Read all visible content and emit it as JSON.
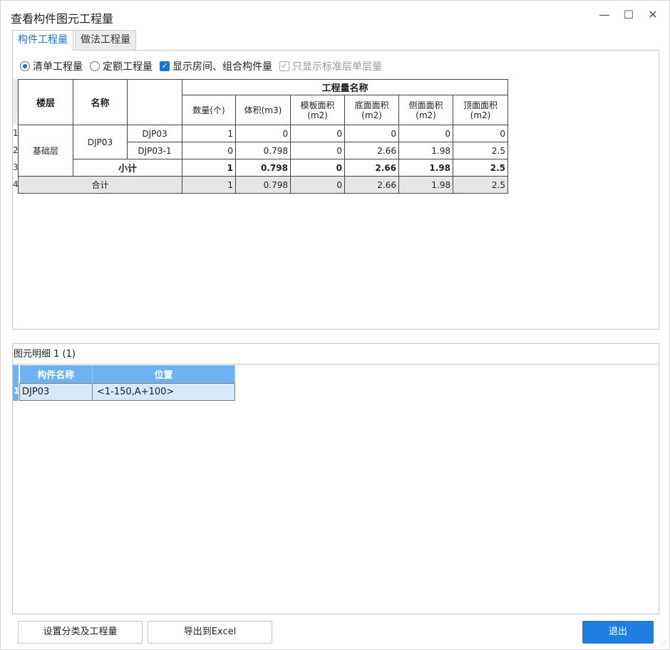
{
  "window": {
    "title": "查看构件图元工程量",
    "minimize": "—",
    "maximize": "☐",
    "close": "✕"
  },
  "tabs": [
    {
      "label": "构件工程量"
    },
    {
      "label": "做法工程量"
    }
  ],
  "options": {
    "radio1": "清单工程量",
    "radio2": "定额工程量",
    "check1": "显示房间、组合构件量",
    "check2": "只显示标准层单层量"
  },
  "table": {
    "header": {
      "floor": "楼层",
      "name": "名称",
      "group": "工程量名称",
      "cols": [
        "数量(个)",
        "体积(m3)",
        "模板面积(m2)",
        "底面面积(m2)",
        "侧面面积(m2)",
        "顶面面积(m2)"
      ]
    },
    "row_numbers": [
      "1",
      "2",
      "3",
      "4"
    ],
    "floor": "基础层",
    "name": "DJP03",
    "rows": [
      {
        "sub": "DJP03",
        "values": [
          "1",
          "0",
          "0",
          "0",
          "0",
          "0"
        ]
      },
      {
        "sub": "DJP03-1",
        "values": [
          "0",
          "0.798",
          "0",
          "2.66",
          "1.98",
          "2.5"
        ]
      }
    ],
    "subtotal": {
      "label": "小计",
      "values": [
        "1",
        "0.798",
        "0",
        "2.66",
        "1.98",
        "2.5"
      ]
    },
    "total": {
      "label": "合计",
      "values": [
        "1",
        "0.798",
        "0",
        "2.66",
        "1.98",
        "2.5"
      ]
    }
  },
  "detail": {
    "label": "图元明细  1 (1)",
    "headers": [
      "构件名称",
      "位置"
    ],
    "rows": [
      {
        "num": "1",
        "name": "DJP03",
        "pos": "<1-150,A+100>"
      }
    ]
  },
  "buttons": {
    "classify": "设置分类及工程量",
    "export": "导出到Excel",
    "exit": "退出"
  }
}
